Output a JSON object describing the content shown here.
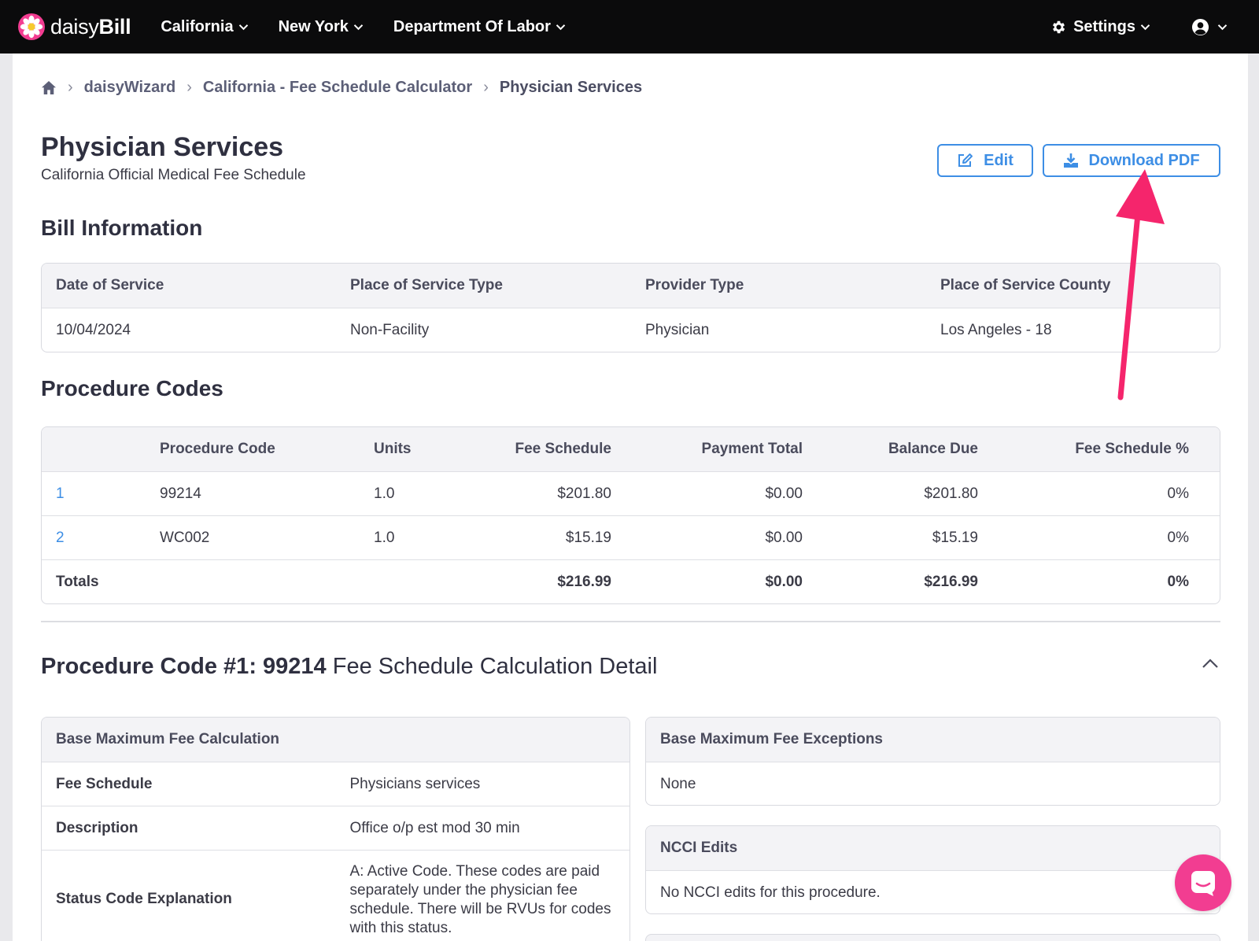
{
  "brand": {
    "prefix": "daisy",
    "suffix": "Bill"
  },
  "nav": {
    "items": [
      "California",
      "New York",
      "Department Of Labor"
    ],
    "settings": "Settings"
  },
  "breadcrumb": [
    "daisyWizard",
    "California - Fee Schedule Calculator",
    "Physician Services"
  ],
  "page": {
    "title": "Physician Services",
    "subtitle": "California Official Medical Fee Schedule",
    "edit_label": "Edit",
    "pdf_label": "Download PDF"
  },
  "bill": {
    "heading": "Bill Information",
    "headers": [
      "Date of Service",
      "Place of Service Type",
      "Provider Type",
      "Place of Service County"
    ],
    "values": [
      "10/04/2024",
      "Non-Facility",
      "Physician",
      "Los Angeles - 18"
    ]
  },
  "procedures": {
    "heading": "Procedure Codes",
    "headers": [
      "",
      "Procedure Code",
      "Units",
      "Fee Schedule",
      "Payment Total",
      "Balance Due",
      "Fee Schedule %"
    ],
    "rows": [
      [
        "1",
        "99214",
        "1.0",
        "$201.80",
        "$0.00",
        "$201.80",
        "0%"
      ],
      [
        "2",
        "WC002",
        "1.0",
        "$15.19",
        "$0.00",
        "$15.19",
        "0%"
      ]
    ],
    "totals": [
      "Totals",
      "",
      "",
      "$216.99",
      "$0.00",
      "$216.99",
      "0%"
    ]
  },
  "detail": {
    "title_bold": "Procedure Code #1: 99214",
    "title_rest": " Fee Schedule Calculation Detail",
    "base_calc": {
      "heading": "Base Maximum Fee Calculation",
      "rows": [
        [
          "Fee Schedule",
          "Physicians services"
        ],
        [
          "Description",
          "Office o/p est mod 30 min"
        ],
        [
          "Status Code Explanation",
          "A: Active Code. These codes are paid separately under the physician fee schedule. There will be RVUs for codes with this status."
        ]
      ]
    },
    "exceptions": {
      "heading": "Base Maximum Fee Exceptions",
      "value": "None"
    },
    "ncci": {
      "heading": "NCCI Edits",
      "value": "No NCCI edits for this procedure."
    }
  },
  "colors": {
    "accent": "#3d8ee5",
    "brand_pink": "#f23d91",
    "annotation_arrow": "#f5256c",
    "nav_bg": "#0b0b0c"
  },
  "icons": [
    "daisy-logo-icon",
    "chevron-down-icon",
    "gear-icon",
    "user-circle-icon",
    "home-icon",
    "chevron-right-icon",
    "edit-icon",
    "download-icon",
    "chevron-up-icon",
    "chat-icon",
    "annotation-arrow"
  ]
}
